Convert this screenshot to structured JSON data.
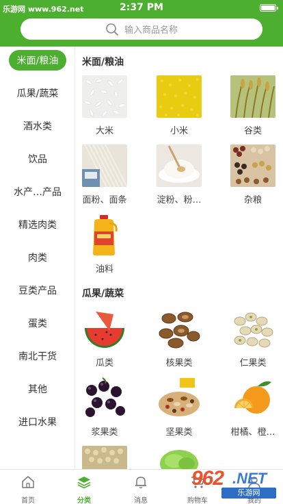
{
  "status_bar": {
    "watermark": "乐游网 www.962.net",
    "time": "2:37 PM"
  },
  "search": {
    "placeholder": "输入商品名称",
    "icon": "search-icon"
  },
  "colors": {
    "brand_green": "#4caf2f"
  },
  "sidebar": {
    "items": [
      {
        "label": "米面/粮油",
        "active": true
      },
      {
        "label": "瓜果/蔬菜"
      },
      {
        "label": "酒水类"
      },
      {
        "label": "饮品"
      },
      {
        "label": "水产…产品"
      },
      {
        "label": "精选肉类"
      },
      {
        "label": "肉类"
      },
      {
        "label": "豆类产品"
      },
      {
        "label": "蛋类"
      },
      {
        "label": "南北干货"
      },
      {
        "label": "其他"
      },
      {
        "label": "进口水果"
      }
    ]
  },
  "sections": [
    {
      "title": "米面/粮油",
      "items": [
        {
          "label": "大米",
          "icon": "rice-image"
        },
        {
          "label": "小米",
          "icon": "millet-image"
        },
        {
          "label": "谷类",
          "icon": "grain-image"
        },
        {
          "label": "面粉、面条",
          "icon": "noodles-image"
        },
        {
          "label": "淀粉、粉…",
          "icon": "flour-image"
        },
        {
          "label": "杂粮",
          "icon": "beans-image"
        },
        {
          "label": "油料",
          "icon": "oil-bottle-image"
        }
      ]
    },
    {
      "title": "瓜果/蔬菜",
      "items": [
        {
          "label": "瓜类",
          "icon": "watermelon-image"
        },
        {
          "label": "核果类",
          "icon": "pecan-image"
        },
        {
          "label": "仁果类",
          "icon": "pistachio-image"
        },
        {
          "label": "浆果类",
          "icon": "berries-image"
        },
        {
          "label": "坚果类",
          "icon": "mixed-nuts-image"
        },
        {
          "label": "柑橘、橙…",
          "icon": "orange-image"
        }
      ]
    }
  ],
  "tabbar": {
    "items": [
      {
        "label": "首页",
        "icon": "home-icon"
      },
      {
        "label": "分类",
        "icon": "layers-icon",
        "active": true
      },
      {
        "label": "消息",
        "icon": "bell-icon"
      },
      {
        "label": "购物车",
        "icon": "cart-icon"
      },
      {
        "label": "我的",
        "icon": "user-icon"
      }
    ]
  },
  "watermark_logo": {
    "number": "962",
    "suffix": ".NET",
    "caption": "乐游网"
  }
}
